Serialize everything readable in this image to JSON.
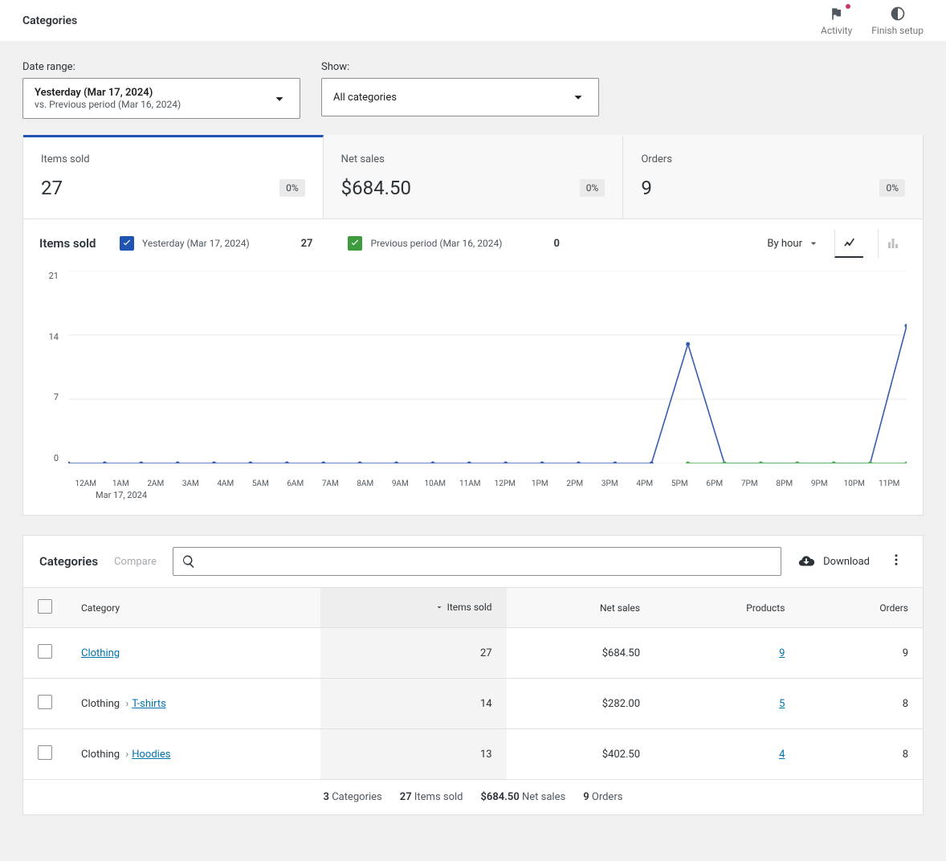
{
  "topbar": {
    "title": "Categories",
    "activity": "Activity",
    "finish": "Finish setup"
  },
  "filters": {
    "date_label": "Date range:",
    "date_main": "Yesterday (Mar 17, 2024)",
    "date_sub": "vs. Previous period (Mar 16, 2024)",
    "show_label": "Show:",
    "show_value": "All categories"
  },
  "summary": [
    {
      "label": "Items sold",
      "value": "27",
      "pct": "0%",
      "active": true
    },
    {
      "label": "Net sales",
      "value": "$684.50",
      "pct": "0%",
      "active": false
    },
    {
      "label": "Orders",
      "value": "9",
      "pct": "0%",
      "active": false
    }
  ],
  "chart": {
    "title": "Items sold",
    "legend": [
      {
        "color": "blue",
        "label": "Yesterday (Mar 17, 2024)",
        "value": "27"
      },
      {
        "color": "green",
        "label": "Previous period (Mar 16, 2024)",
        "value": "0"
      }
    ],
    "interval": "By hour",
    "date_below": "Mar 17, 2024"
  },
  "chart_data": {
    "type": "line",
    "categories": [
      "12AM",
      "1AM",
      "2AM",
      "3AM",
      "4AM",
      "5AM",
      "6AM",
      "7AM",
      "8AM",
      "9AM",
      "10AM",
      "11AM",
      "12PM",
      "1PM",
      "2PM",
      "3PM",
      "4PM",
      "5PM",
      "6PM",
      "7PM",
      "8PM",
      "9PM",
      "10PM",
      "11PM"
    ],
    "series": [
      {
        "name": "Yesterday (Mar 17, 2024)",
        "values": [
          0,
          0,
          0,
          0,
          0,
          0,
          0,
          0,
          0,
          0,
          0,
          0,
          0,
          0,
          0,
          0,
          0,
          13,
          0,
          0,
          0,
          0,
          0,
          15
        ]
      },
      {
        "name": "Previous period (Mar 16, 2024)",
        "values": [
          null,
          null,
          null,
          null,
          null,
          null,
          null,
          null,
          null,
          null,
          null,
          null,
          null,
          null,
          null,
          null,
          null,
          0,
          0,
          0,
          0,
          0,
          0,
          0
        ]
      }
    ],
    "y_ticks": [
      0,
      7,
      14,
      21
    ],
    "ylim": [
      0,
      21
    ],
    "title": "Items sold",
    "xlabel": "",
    "ylabel": ""
  },
  "table": {
    "title": "Categories",
    "compare": "Compare",
    "download": "Download",
    "columns": [
      "Category",
      "Items sold",
      "Net sales",
      "Products",
      "Orders"
    ],
    "rows": [
      {
        "path": [
          {
            "t": "Clothing",
            "link": true
          }
        ],
        "items": "27",
        "net": "$684.50",
        "products": "9",
        "orders": "9"
      },
      {
        "path": [
          {
            "t": "Clothing",
            "link": false
          },
          {
            "t": "T-shirts",
            "link": true
          }
        ],
        "items": "14",
        "net": "$282.00",
        "products": "5",
        "orders": "8"
      },
      {
        "path": [
          {
            "t": "Clothing",
            "link": false
          },
          {
            "t": "Hoodies",
            "link": true
          }
        ],
        "items": "13",
        "net": "$402.50",
        "products": "4",
        "orders": "8"
      }
    ],
    "footer": {
      "cats": "3",
      "cats_l": "Categories",
      "items": "27",
      "items_l": "Items sold",
      "net": "$684.50",
      "net_l": "Net sales",
      "orders": "9",
      "orders_l": "Orders"
    }
  }
}
